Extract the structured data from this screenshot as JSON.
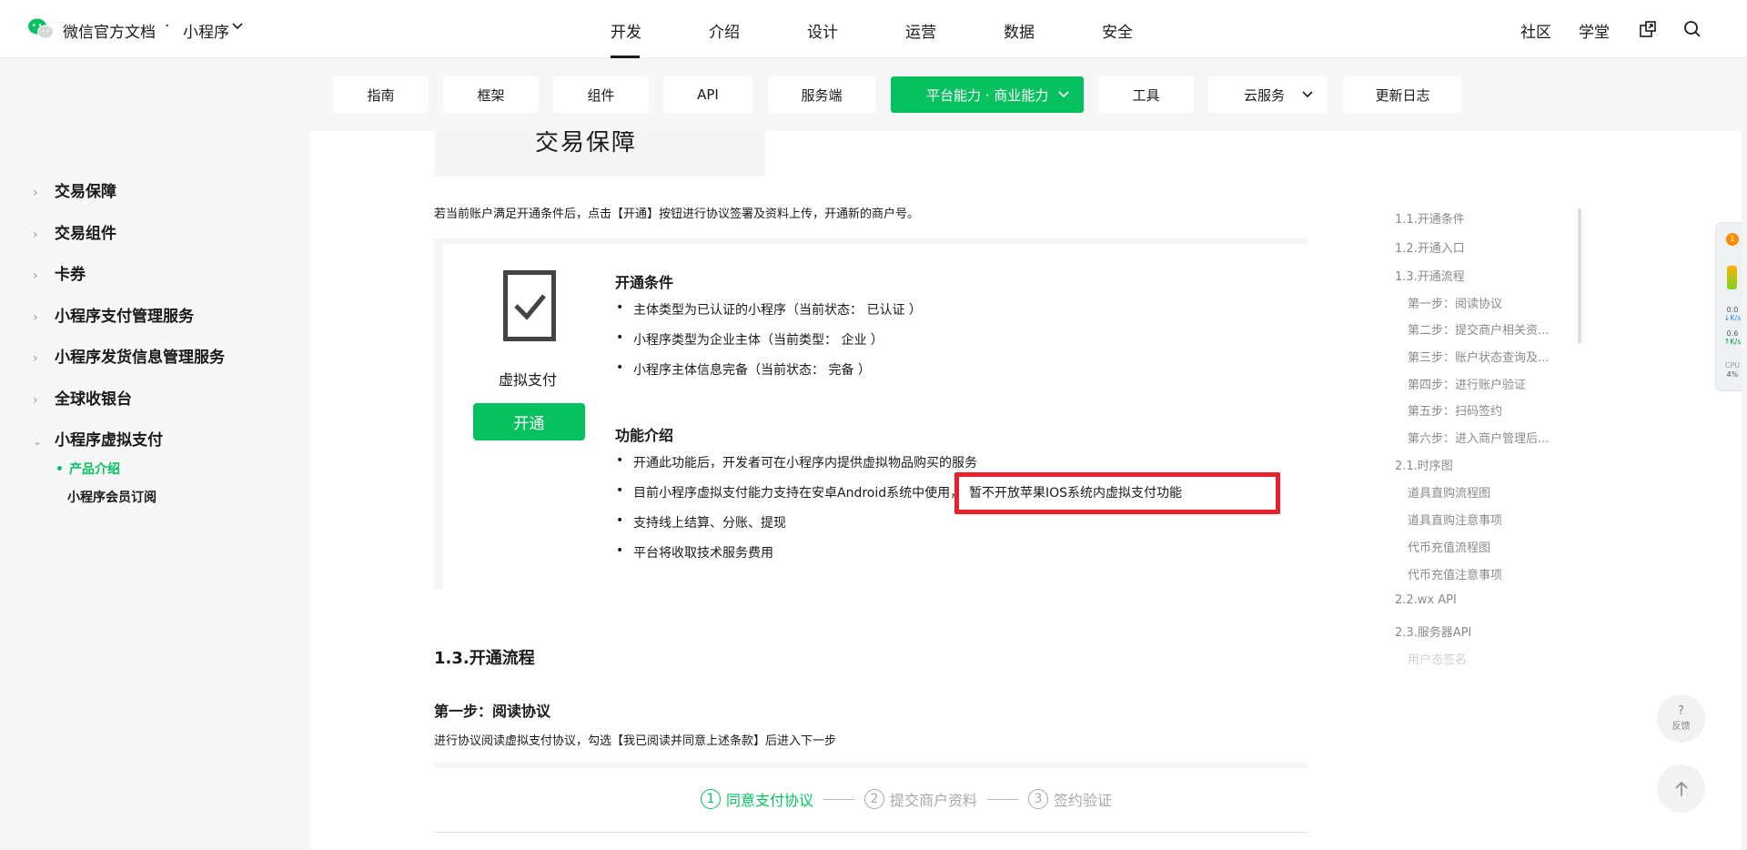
{
  "header": {
    "brand": "微信官方文档",
    "dot": "·",
    "product": "小程序",
    "tabs": [
      "开发",
      "介绍",
      "设计",
      "运营",
      "数据",
      "安全"
    ],
    "right_links": [
      "社区",
      "学堂"
    ]
  },
  "subnav": {
    "items": [
      "指南",
      "框架",
      "组件",
      "API",
      "服务端",
      "平台能力 · 商业能力",
      "工具",
      "云服务",
      "更新日志"
    ],
    "active": "平台能力 · 商业能力"
  },
  "sidebar": {
    "items": [
      "交易保障",
      "交易组件",
      "卡券",
      "小程序支付管理服务",
      "小程序发货信息管理服务",
      "全球收银台",
      "小程序虚拟支付"
    ],
    "sub_items": [
      "产品介绍",
      "小程序会员订阅"
    ],
    "active_sub": "产品介绍"
  },
  "content": {
    "top_card_text": "交易保障",
    "intro": "若当前账户满足开通条件后，点击【开通】按钮进行协议签署及资料上传，开通新的商户号。",
    "vp_label": "虚拟支付",
    "open_button": "开通",
    "conditions_title": "开通条件",
    "conditions": [
      "主体类型为已认证的小程序（当前状态： 已认证 ）",
      "小程序类型为企业主体（当前类型： 企业 ）",
      "小程序主体信息完备（当前状态： 完备 ）"
    ],
    "features_title": "功能介绍",
    "features": [
      "开通此功能后，开发者可在小程序内提供虚拟物品购买的服务",
      "目前小程序虚拟支付能力支持在安卓Android系统中使用，",
      "支持线上结算、分账、提现",
      "平台将收取技术服务费用"
    ],
    "highlight": "暂不开放苹果IOS系统内虚拟支付功能",
    "section_heading": "1.3.开通流程",
    "step1_heading": "第一步：阅读协议",
    "step1_text": "进行协议阅读虚拟支付协议，勾选【我已阅读并同意上述条款】后进入下一步",
    "steps": [
      {
        "num": "1",
        "label": "同意支付协议"
      },
      {
        "num": "2",
        "label": "提交商户资料"
      },
      {
        "num": "3",
        "label": "签约验证"
      }
    ]
  },
  "toc": [
    "1.1.开通条件",
    "1.2.开通入口",
    "1.3.开通流程",
    "第一步：阅读协议",
    "第二步：提交商户相关资...",
    "第三步：账户状态查询及...",
    "第四步：进行账户验证",
    "第五步：扫码签约",
    "第六步：进入商户管理后...",
    "2.1.时序图",
    "道具直购流程图",
    "道具直购注意事项",
    "代币充值流程图",
    "代币充值注意事项",
    "2.2.wx API",
    "2.3.服务器API",
    "用户态签名"
  ],
  "monitor": {
    "badge": "1",
    "down_value": "0.0",
    "down_unit": "K/s",
    "up_value": "0.6",
    "up_unit": "K/s",
    "cpu_label": "CPU",
    "cpu_value": "4",
    "cpu_unit": "%"
  },
  "feedback": {
    "symbol": "?",
    "label": "反馈"
  },
  "colors": {
    "accent": "#07c160",
    "highlight": "#e8202a"
  }
}
